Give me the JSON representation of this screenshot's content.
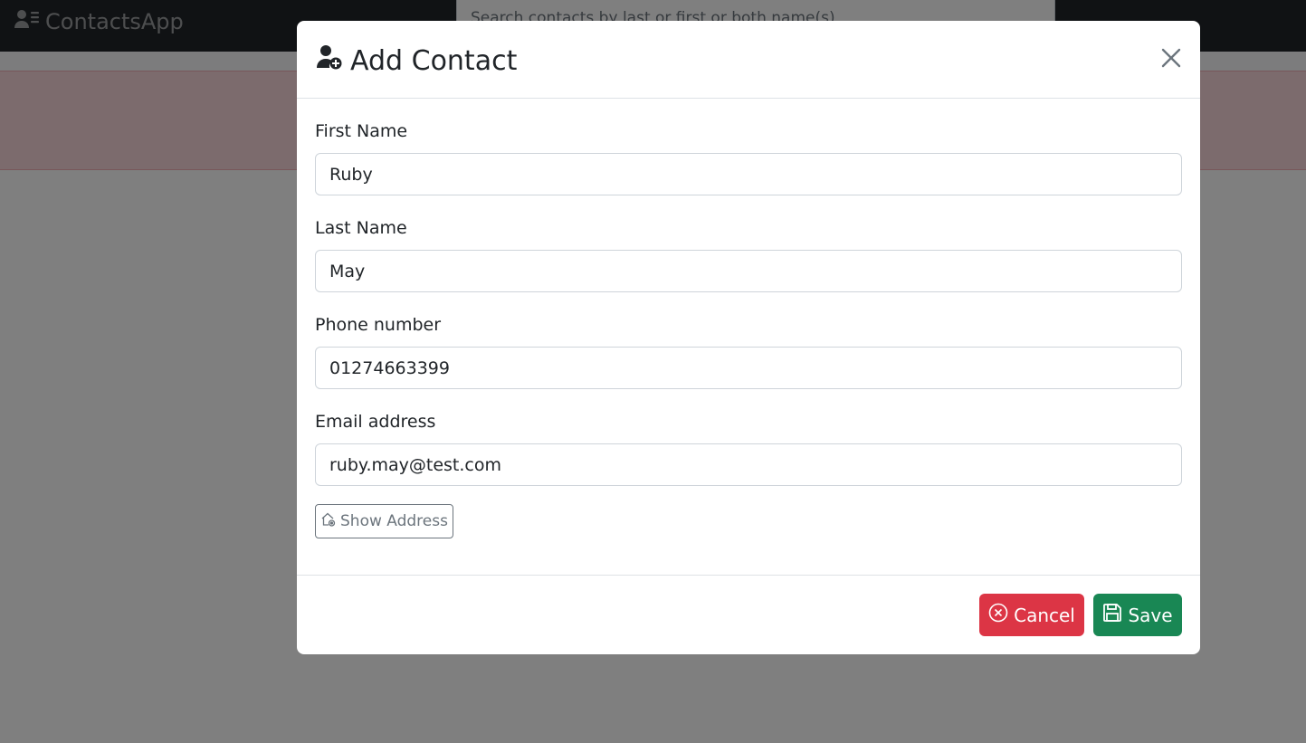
{
  "navbar": {
    "brand": "ContactsApp",
    "search_placeholder": "Search contacts by last or first or both name(s)"
  },
  "modal": {
    "title": "Add Contact",
    "fields": [
      {
        "label": "First Name",
        "value": "Ruby"
      },
      {
        "label": "Last Name",
        "value": "May"
      },
      {
        "label": "Phone number",
        "value": "01274663399"
      },
      {
        "label": "Email address",
        "value": "ruby.may@test.com"
      }
    ],
    "show_address_label": "Show Address",
    "cancel_label": "Cancel",
    "save_label": "Save"
  },
  "colors": {
    "navbar": "#212529",
    "danger": "#dc3545",
    "success": "#198754",
    "secondary": "#6c757d",
    "alert_bg": "#f8d7da"
  },
  "icons": {
    "brand": "contacts-list-icon",
    "title": "person-plus-icon",
    "close": "close-icon",
    "show_address": "house-gear-icon",
    "cancel": "x-circle-icon",
    "save": "floppy-disk-icon"
  }
}
